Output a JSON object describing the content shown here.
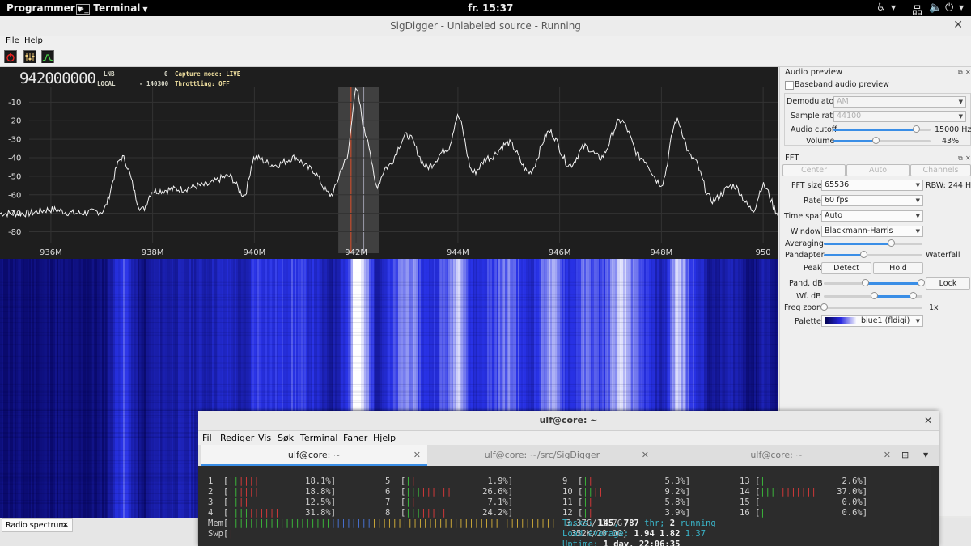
{
  "topbar": {
    "apps_label": "Programmer",
    "terminal_label": "Terminal",
    "clock": "fr. 15:37"
  },
  "window": {
    "title": "SigDigger - Unlabeled source - Running",
    "menu": [
      "File",
      "Help"
    ]
  },
  "spectrum": {
    "frequency": "942000000",
    "lnb_label": "LNB",
    "lnb_value": "0",
    "local_label": "LOCAL",
    "local_value": "- 140300",
    "capture_mode": "Capture mode: LIVE",
    "throttling": "Throttling: OFF",
    "y_ticks": [
      "-10",
      "-20",
      "-30",
      "-40",
      "-50",
      "-60",
      "-70",
      "-80"
    ],
    "x_ticks": [
      "936M",
      "938M",
      "940M",
      "942M",
      "944M",
      "946M",
      "948M",
      "950"
    ],
    "colors": {
      "background": "#1e1e1e",
      "trace": "#f2f2f2",
      "cursor": "#e0502a",
      "band": "#6a6a6a"
    }
  },
  "chart_data": {
    "type": "line",
    "title": "",
    "xlabel": "",
    "ylabel": "",
    "xlim": [
      935,
      950.3
    ],
    "ylim": [
      -85,
      -2
    ],
    "x_tick_labels": [
      "936M",
      "938M",
      "940M",
      "942M",
      "944M",
      "946M",
      "948M",
      "950"
    ],
    "y_tick_labels": [
      "-10",
      "-20",
      "-30",
      "-40",
      "-50",
      "-60",
      "-70",
      "-80"
    ],
    "grid": true,
    "series": [
      {
        "x": [
          935.0,
          935.5,
          936.0,
          936.5,
          937.0,
          937.4,
          937.8,
          938.0,
          938.5,
          939.0,
          939.5,
          939.8,
          940.0,
          940.4,
          940.8,
          941.1,
          941.5,
          941.8,
          942.0,
          942.2,
          942.4,
          942.6,
          943.0,
          943.4,
          943.8,
          944.0,
          944.3,
          944.6,
          945.0,
          945.4,
          945.8,
          946.2,
          946.5,
          946.8,
          947.2,
          947.6,
          948.0,
          948.3,
          948.6,
          949.0,
          949.4,
          949.8,
          950.0,
          950.3
        ],
        "y": [
          -70,
          -70,
          -68,
          -70,
          -69,
          -40,
          -68,
          -58,
          -57,
          -55,
          -50,
          -60,
          -40,
          -44,
          -40,
          -46,
          -60,
          -42,
          -4,
          -28,
          -55,
          -45,
          -28,
          -45,
          -35,
          -18,
          -48,
          -40,
          -32,
          -48,
          -26,
          -44,
          -34,
          -40,
          -20,
          -40,
          -54,
          -20,
          -40,
          -63,
          -55,
          -68,
          -55,
          -70
        ]
      }
    ]
  },
  "audio_preview": {
    "title": "Audio preview",
    "baseband_label": "Baseband audio preview",
    "demodulator_label": "Demodulator",
    "demodulator_value": "AM",
    "sample_rate_label": "Sample rate",
    "sample_rate_value": "44100",
    "cutoff_label": "Audio cutoff",
    "cutoff_value": "15000 Hz",
    "cutoff_level": 0.85,
    "volume_label": "Volume",
    "volume_value": "43%",
    "volume_level": 0.43
  },
  "fft": {
    "title": "FFT",
    "btn_center": "Center",
    "btn_auto": "Auto",
    "btn_channels": "Channels",
    "size_label": "FFT size",
    "size_value": "65536",
    "rbw": "RBW: 244 Hz",
    "rate_label": "Rate",
    "rate_value": "60 fps",
    "timespan_label": "Time span",
    "timespan_value": "Auto",
    "window_label": "Window",
    "window_value": "Blackmann-Harris",
    "averaging_label": "Averaging",
    "averaging_level": 0.68,
    "pandapter_label": "Pandapter",
    "waterfall_label": "Waterfall",
    "pw_level": 0.4,
    "peak_label": "Peak",
    "detect_label": "Detect",
    "hold_label": "Hold",
    "pand_db_label": "Pand. dB",
    "pand_db_lo": 0.42,
    "pand_db_hi": 0.98,
    "lock_label": "Lock",
    "wf_db_label": "Wf. dB",
    "wf_db_lo": 0.51,
    "wf_db_hi": 0.9,
    "freq_zoom_label": "Freq zoom",
    "freq_zoom_value": "1x",
    "freq_zoom_level": 0.0,
    "palette_label": "Palette",
    "palette_value": "blue1 (fldigi)"
  },
  "bottom_tab": {
    "label": "Radio spectrum"
  },
  "terminal": {
    "title": "ulf@core: ~",
    "menu": [
      "Fil",
      "Rediger",
      "Vis",
      "Søk",
      "Terminal",
      "Faner",
      "Hjelp"
    ],
    "tabs": [
      "ulf@core: ~",
      "ulf@core: ~/src/SigDigger",
      "ulf@core: ~"
    ],
    "cpus": [
      {
        "n": "1",
        "bar": "||||||",
        "pct": "18.1%"
      },
      {
        "n": "2",
        "bar": "||||||",
        "pct": "18.8%"
      },
      {
        "n": "3",
        "bar": "||||",
        "pct": "12.5%"
      },
      {
        "n": "4",
        "bar": "||||||||||",
        "pct": "31.8%"
      },
      {
        "n": "5",
        "bar": "||",
        "pct": "1.9%"
      },
      {
        "n": "6",
        "bar": "|||||||||",
        "pct": "26.6%"
      },
      {
        "n": "7",
        "bar": "||",
        "pct": "7.1%"
      },
      {
        "n": "8",
        "bar": "||||||||",
        "pct": "24.2%"
      },
      {
        "n": "9",
        "bar": "||",
        "pct": "5.3%"
      },
      {
        "n": "10",
        "bar": "||||",
        "pct": "9.2%"
      },
      {
        "n": "11",
        "bar": "||",
        "pct": "5.8%"
      },
      {
        "n": "12",
        "bar": "||",
        "pct": "3.9%"
      },
      {
        "n": "13",
        "bar": "|",
        "pct": "2.6%"
      },
      {
        "n": "14",
        "bar": "|||||||||||",
        "pct": "37.0%"
      },
      {
        "n": "15",
        "bar": "",
        "pct": "0.0%"
      },
      {
        "n": "16",
        "bar": "|",
        "pct": "0.6%"
      }
    ],
    "mem_label": "Mem",
    "mem_value": "3.37G/11.7G",
    "swp_label": "Swp",
    "swp_value": "352K/20.0G",
    "tasks_label": "Tasks: ",
    "tasks_count": "145",
    "thr_count": "787",
    "thr_label": " thr; ",
    "running_count": "2",
    "running_label": " running",
    "load_label": "Load average: ",
    "load1": "1.94",
    "load5": "1.82",
    "load15": "1.37",
    "uptime_label": "Uptime: ",
    "uptime_value": "1 day, 22:06:35"
  }
}
